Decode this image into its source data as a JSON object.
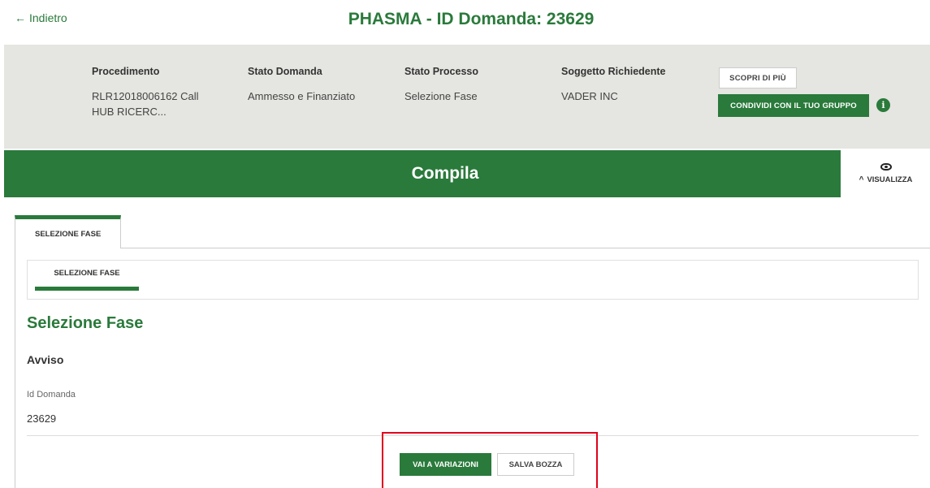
{
  "header": {
    "back_label": "Indietro",
    "title": "PHASMA - ID Domanda: 23629"
  },
  "info": {
    "procedimento": {
      "label": "Procedimento",
      "value_line1": "RLR12018006162 Call",
      "value_line2": "HUB RICERC..."
    },
    "stato_domanda": {
      "label": "Stato Domanda",
      "value": "Ammesso e Finanziato"
    },
    "stato_processo": {
      "label": "Stato Processo",
      "value": "Selezione Fase"
    },
    "soggetto": {
      "label": "Soggetto Richiedente",
      "value": "VADER INC"
    },
    "scopri_label": "SCOPRI DI PIÙ",
    "condividi_label": "CONDIVIDI CON IL TUO GRUPPO",
    "info_icon_glyph": "i"
  },
  "compila_bar": {
    "title": "Compila",
    "visualizza_label": "VISUALIZZA"
  },
  "tabs": {
    "outer_tab_label": "SELEZIONE FASE",
    "sub_tab_label": "SELEZIONE FASE"
  },
  "section": {
    "title": "Selezione Fase",
    "subtitle": "Avviso",
    "id_label": "Id Domanda",
    "id_value": "23629"
  },
  "actions": {
    "vai_label": "VAI A VARIAZIONI",
    "salva_label": "SALVA BOZZA"
  },
  "colors": {
    "primary_green": "#2a7a3b",
    "panel_gray": "#e5e5e1",
    "highlight_red": "#e0001b"
  }
}
